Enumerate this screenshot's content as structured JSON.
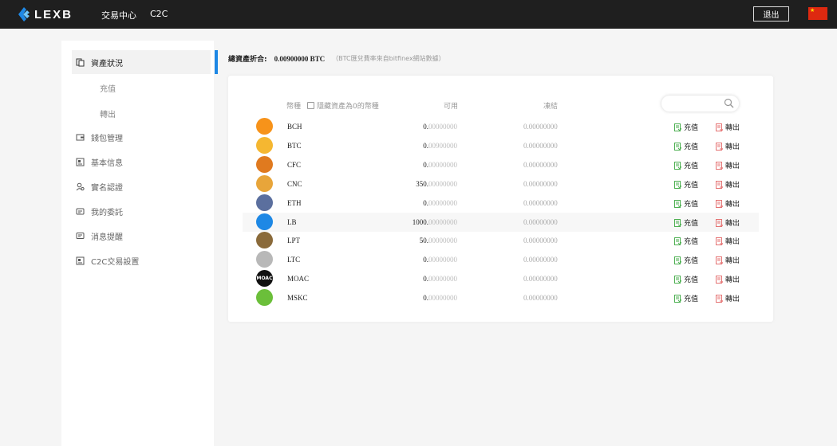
{
  "header": {
    "logo_text": "LEXB",
    "nav": [
      "交易中心",
      "C2C"
    ],
    "logout_label": "退出",
    "flag": "china-flag"
  },
  "sidebar": {
    "items": [
      {
        "label": "資產狀況",
        "icon": "assets-icon",
        "active": true
      },
      {
        "label": "充值",
        "sub": true
      },
      {
        "label": "轉出",
        "sub": true
      },
      {
        "label": "錢包管理",
        "icon": "wallet-icon"
      },
      {
        "label": "基本信息",
        "icon": "profile-card-icon"
      },
      {
        "label": "實名認證",
        "icon": "user-verify-icon"
      },
      {
        "label": "我的委託",
        "icon": "orders-icon"
      },
      {
        "label": "消息提醒",
        "icon": "message-icon"
      },
      {
        "label": "C2C交易設置",
        "icon": "c2c-settings-icon"
      }
    ]
  },
  "summary": {
    "label": "總資產折合:",
    "value": "0.00900000 BTC",
    "note": "（BTC匯兌費率來自bitfinex網站數據）"
  },
  "table": {
    "headers": {
      "coin": "幣種",
      "hide_zero": "隱藏資產為0的幣種",
      "available": "可用",
      "frozen": "凍結"
    },
    "search_placeholder": "",
    "deposit_label": "充值",
    "withdraw_label": "轉出",
    "rows": [
      {
        "coin": "BCH",
        "avail_int": "0.",
        "avail_dec": "00000000",
        "frozen": "0.00000000",
        "icon_color": "#f7931a",
        "icon": "bch-coin-icon"
      },
      {
        "coin": "BTC",
        "avail_int": "0.",
        "avail_dec": "00900000",
        "frozen": "0.00000000",
        "icon_color": "#f5b731",
        "icon": "btc-coin-icon"
      },
      {
        "coin": "CFC",
        "avail_int": "0.",
        "avail_dec": "00000000",
        "frozen": "0.00000000",
        "icon_color": "#e07a1f",
        "icon": "cfc-coin-icon"
      },
      {
        "coin": "CNC",
        "avail_int": "350.",
        "avail_dec": "00000000",
        "frozen": "0.00000000",
        "icon_color": "#e8a53a",
        "icon": "cnc-coin-icon"
      },
      {
        "coin": "ETH",
        "avail_int": "0.",
        "avail_dec": "00000000",
        "frozen": "0.00000000",
        "icon_color": "#5b6f9e",
        "icon": "eth-coin-icon"
      },
      {
        "coin": "LB",
        "avail_int": "1000.",
        "avail_dec": "00000000",
        "frozen": "0.00000000",
        "icon_color": "#1e88e5",
        "icon": "lb-coin-icon",
        "highlight": true
      },
      {
        "coin": "LPT",
        "avail_int": "50.",
        "avail_dec": "00000000",
        "frozen": "0.00000000",
        "icon_color": "#8a6a3a",
        "icon": "lpt-coin-icon"
      },
      {
        "coin": "LTC",
        "avail_int": "0.",
        "avail_dec": "00000000",
        "frozen": "0.00000000",
        "icon_color": "#b8b8b8",
        "icon": "ltc-coin-icon"
      },
      {
        "coin": "MOAC",
        "avail_int": "0.",
        "avail_dec": "00000000",
        "frozen": "0.00000000",
        "icon_color": "#111111",
        "icon": "moac-coin-icon",
        "icon_text": "MOAC"
      },
      {
        "coin": "MSKC",
        "avail_int": "0.",
        "avail_dec": "00000000",
        "frozen": "0.00000000",
        "icon_color": "#6bbf3a",
        "icon": "mskc-coin-icon"
      }
    ]
  },
  "colors": {
    "accent": "#1e88e5",
    "topbar": "#1f1f1f",
    "deposit_icon": "#4caf50",
    "withdraw_icon": "#e57373"
  }
}
